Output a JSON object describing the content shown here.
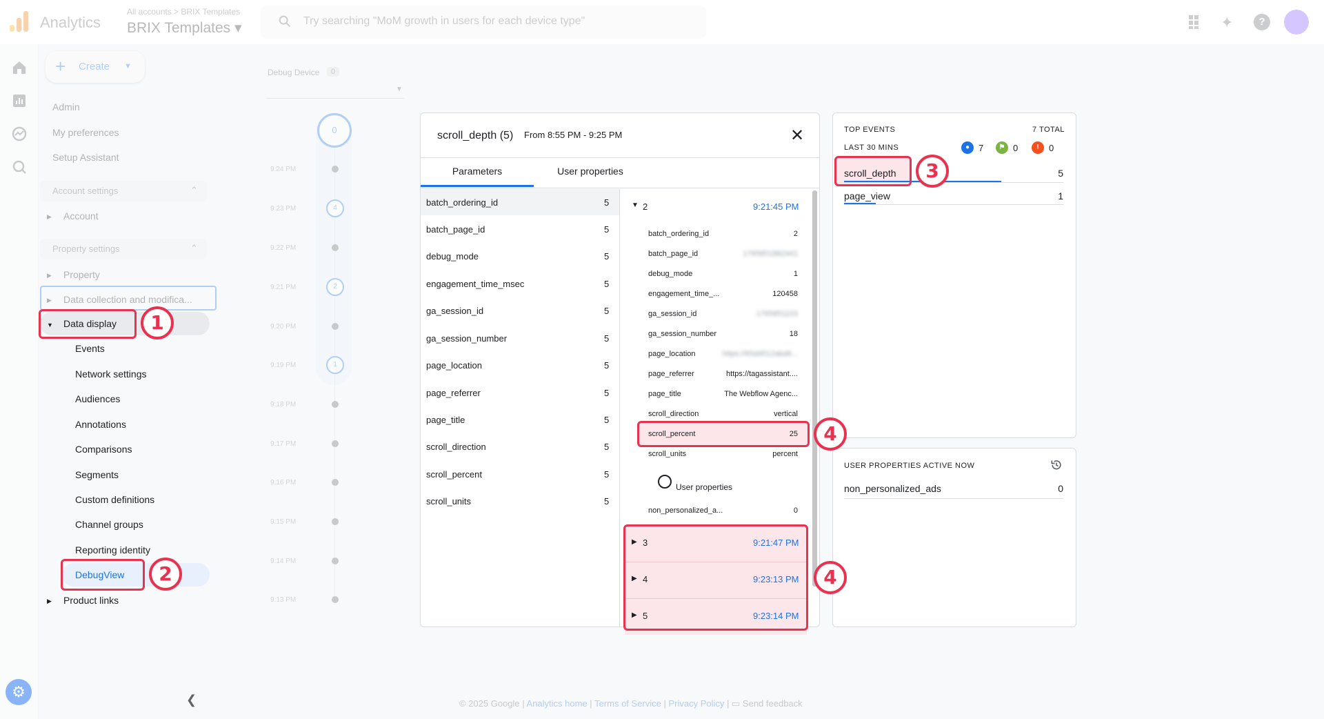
{
  "topbar": {
    "app_name": "Analytics",
    "crumb_small": "All accounts > BRIX Templates",
    "property": "BRIX Templates ▾",
    "search_placeholder": "Try searching \"MoM growth in users for each device type\""
  },
  "nav": {
    "create_label": "Create",
    "admin": "Admin",
    "my_preferences": "My preferences",
    "setup_assistant": "Setup Assistant",
    "account_settings": "Account settings",
    "account": "Account",
    "property_settings": "Property settings",
    "property": "Property",
    "data_collection": "Data collection and modifica...",
    "data_display": "Data display",
    "items": [
      "Events",
      "Network settings",
      "Audiences",
      "Annotations",
      "Comparisons",
      "Segments",
      "Custom definitions",
      "Channel groups",
      "Reporting identity",
      "DebugView"
    ],
    "product_links": "Product links"
  },
  "timeline": {
    "device_label": "Debug Device",
    "device_count": "0",
    "top_count": "0",
    "times": [
      "9:24 PM",
      "9:23 PM",
      "9:22 PM",
      "9:21 PM",
      "9:20 PM",
      "9:19 PM",
      "9:18 PM",
      "9:17 PM",
      "9:16 PM",
      "9:15 PM",
      "9:14 PM",
      "9:13 PM"
    ],
    "ring_counts": [
      "4",
      "2",
      "1"
    ]
  },
  "panel": {
    "title": "scroll_depth (5)",
    "range": "From 8:55 PM - 9:25 PM",
    "tab_parameters": "Parameters",
    "tab_user_properties": "User properties",
    "params": [
      {
        "name": "batch_ordering_id",
        "count": "5"
      },
      {
        "name": "batch_page_id",
        "count": "5"
      },
      {
        "name": "debug_mode",
        "count": "5"
      },
      {
        "name": "engagement_time_msec",
        "count": "5"
      },
      {
        "name": "ga_session_id",
        "count": "5"
      },
      {
        "name": "ga_session_number",
        "count": "5"
      },
      {
        "name": "page_location",
        "count": "5"
      },
      {
        "name": "page_referrer",
        "count": "5"
      },
      {
        "name": "page_title",
        "count": "5"
      },
      {
        "name": "scroll_direction",
        "count": "5"
      },
      {
        "name": "scroll_percent",
        "count": "5"
      },
      {
        "name": "scroll_units",
        "count": "5"
      }
    ],
    "event_open": {
      "num": "2",
      "time": "9:21:45 PM"
    },
    "details": [
      {
        "key": "batch_ordering_id",
        "value": "2"
      },
      {
        "key": "batch_page_id",
        "value": "1765851882441"
      },
      {
        "key": "debug_mode",
        "value": "1"
      },
      {
        "key": "engagement_time_...",
        "value": "120458"
      },
      {
        "key": "ga_session_id",
        "value": "1765851103"
      },
      {
        "key": "ga_session_number",
        "value": "18"
      },
      {
        "key": "page_location",
        "value": "https://65d4512abd6..."
      },
      {
        "key": "page_referrer",
        "value": "https://tagassistant...."
      },
      {
        "key": "page_title",
        "value": "The Webflow Agenc..."
      },
      {
        "key": "scroll_direction",
        "value": "vertical"
      },
      {
        "key": "scroll_percent",
        "value": "25"
      },
      {
        "key": "scroll_units",
        "value": "percent"
      }
    ],
    "user_properties_label": "User properties",
    "user_prop": {
      "key": "non_personalized_a...",
      "value": "0"
    },
    "events": [
      {
        "num": "3",
        "time": "9:21:47 PM"
      },
      {
        "num": "4",
        "time": "9:23:13 PM"
      },
      {
        "num": "5",
        "time": "9:23:14 PM"
      }
    ]
  },
  "top_events": {
    "title": "TOP EVENTS",
    "total": "7 TOTAL",
    "window": "LAST 30 MINS",
    "badges": [
      {
        "icon": "user-icon",
        "count": "7",
        "color": "#1a73e8"
      },
      {
        "icon": "flag-icon",
        "count": "0",
        "color": "#7cb342"
      },
      {
        "icon": "error-icon",
        "count": "0",
        "color": "#f4511e"
      }
    ],
    "events": [
      {
        "name": "scroll_depth",
        "count": "5"
      },
      {
        "name": "page_view",
        "count": "1"
      }
    ]
  },
  "user_props_card": {
    "title": "USER PROPERTIES ACTIVE NOW",
    "name": "non_personalized_ads",
    "value": "0"
  },
  "footer": {
    "copyright": "© 2025 Google | ",
    "home": "Analytics home",
    "sep1": " | ",
    "terms": "Terms of Service",
    "sep2": " | ",
    "privacy": "Privacy Policy",
    "sep3": " | ",
    "feedback": "Send feedback"
  },
  "callouts": [
    "1",
    "2",
    "3",
    "4",
    "4"
  ],
  "colors": {
    "accent": "#1a73e8",
    "highlight": "#e8324f"
  }
}
